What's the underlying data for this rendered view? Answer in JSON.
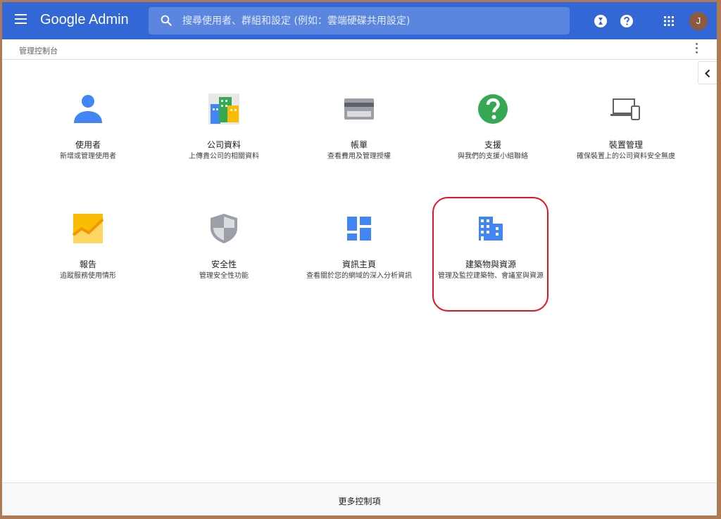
{
  "app": {
    "brand": "Google Admin"
  },
  "search": {
    "placeholder": "搜尋使用者、群組和設定 (例如：雲端硬碟共用設定)"
  },
  "header": {
    "avatar_letter": "J"
  },
  "breadcrumb": {
    "label": "管理控制台"
  },
  "tiles": [
    {
      "title": "使用者",
      "desc": "新增或管理使用者"
    },
    {
      "title": "公司資料",
      "desc": "上傳貴公司的相關資料"
    },
    {
      "title": "帳單",
      "desc": "查看費用及管理授權"
    },
    {
      "title": "支援",
      "desc": "與我們的支援小組聯絡"
    },
    {
      "title": "裝置管理",
      "desc": "確保裝置上的公司資料安全無虞"
    },
    {
      "title": "報告",
      "desc": "追蹤服務使用情形"
    },
    {
      "title": "安全性",
      "desc": "管理安全性功能"
    },
    {
      "title": "資訊主頁",
      "desc": "查看關於您的網域的深入分析資訊"
    },
    {
      "title": "建築物與資源",
      "desc": "管理及監控建築物、會議室與資源"
    }
  ],
  "footer": {
    "more_controls": "更多控制項"
  },
  "colors": {
    "topbar": "#3367d6",
    "highlight": "#e5141f",
    "icon_blue": "#4285f4"
  }
}
